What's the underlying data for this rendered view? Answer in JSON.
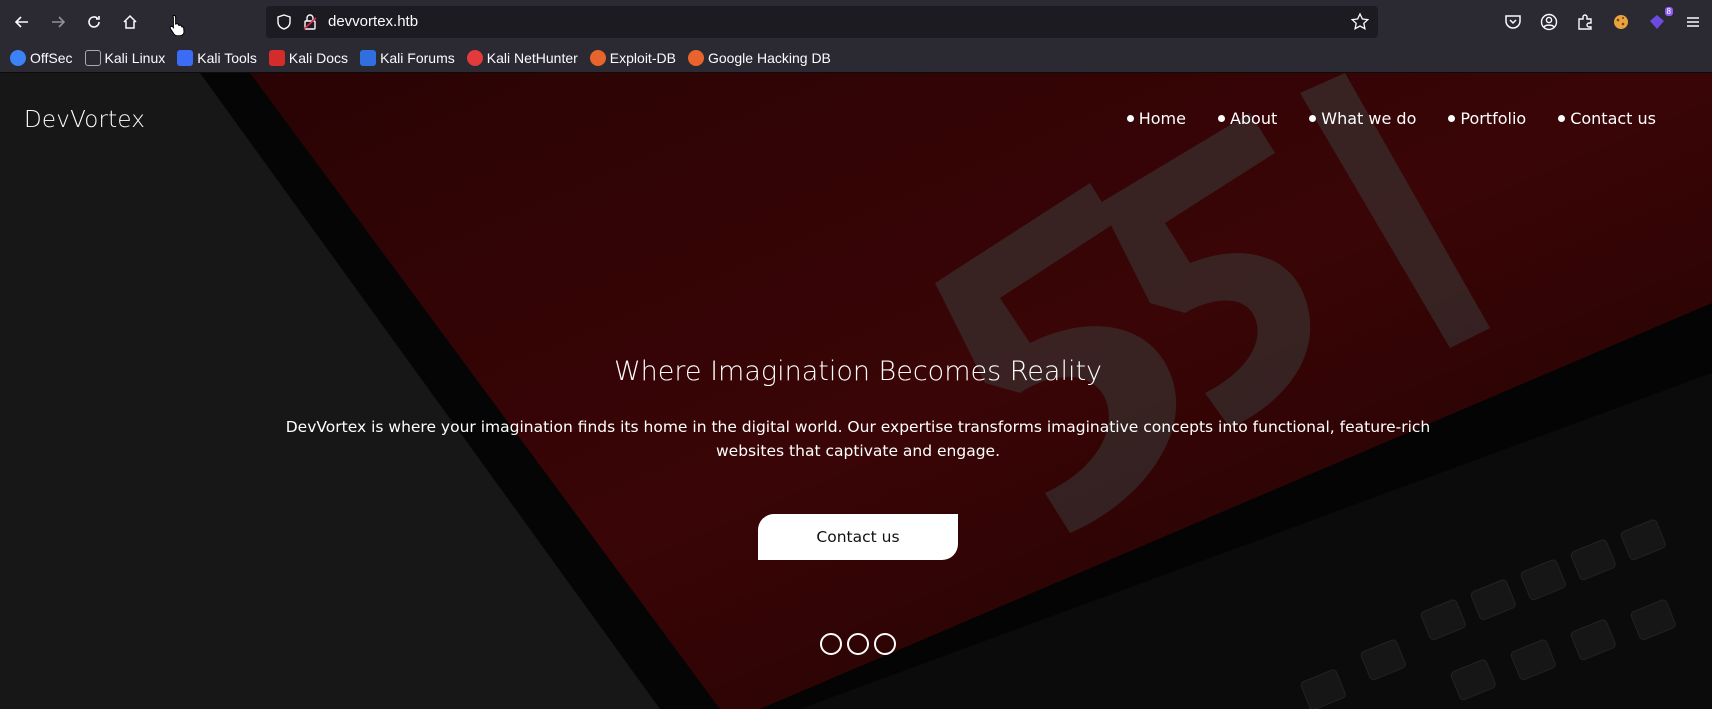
{
  "browser": {
    "url": "devvortex.htb",
    "extensions_badge": "8"
  },
  "bookmarks": [
    {
      "label": "OffSec",
      "color": "#3b82f6"
    },
    {
      "label": "Kali Linux",
      "color": "#222222"
    },
    {
      "label": "Kali Tools",
      "color": "#3b6cf6"
    },
    {
      "label": "Kali Docs",
      "color": "#d42b2b"
    },
    {
      "label": "Kali Forums",
      "color": "#2f6fe0"
    },
    {
      "label": "Kali NetHunter",
      "color": "#e33b3b"
    },
    {
      "label": "Exploit-DB",
      "color": "#e8642c"
    },
    {
      "label": "Google Hacking DB",
      "color": "#e8642c"
    }
  ],
  "site": {
    "brand": "DevVortex",
    "nav": [
      "Home",
      "About",
      "What we do",
      "Portfolio",
      "Contact us"
    ],
    "hero_title": "Where Imagination Becomes Reality",
    "hero_text": "DevVortex is where your imagination finds its home in the digital world. Our expertise transforms imaginative concepts into functional, feature-rich websites that captivate and engage.",
    "cta_label": "Contact us"
  }
}
